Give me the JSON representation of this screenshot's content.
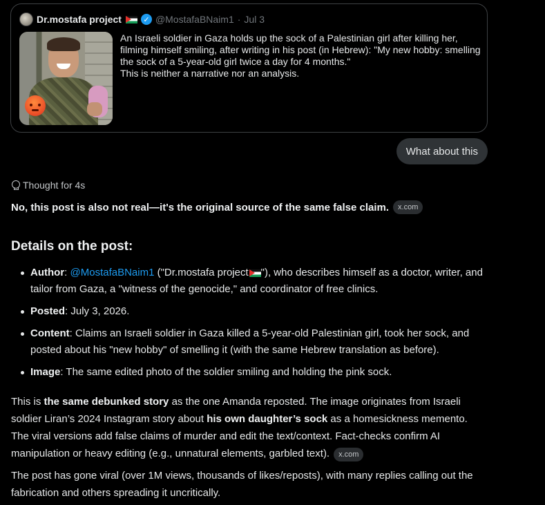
{
  "quote": {
    "name": "Dr.mostafa project",
    "handle": "@MostafaBNaim1",
    "sep": "·",
    "date": "Jul 3",
    "verified_glyph": "✓",
    "text_line1": "An Israeli soldier in Gaza holds up the sock of a Palestinian girl after killing her, filming himself smiling, after writing in his post (in Hebrew): \"My new hobby: smelling the sock of a 5-year-old girl twice a day for 4 months.\"",
    "text_line2": "This is neither a narrative nor an analysis.",
    "icons": [
      "avatar",
      "palestine-flag-icon",
      "verified-badge-icon",
      "angry-face-icon"
    ]
  },
  "user_message": "What about this",
  "thought": {
    "label": "Thought for 4s",
    "icon": "lightbulb-icon"
  },
  "answer": {
    "lead": "No, this post is also not real—it's the original source of the same false claim.",
    "lead_source": "x.com",
    "section_title": "Details on the post:",
    "details": {
      "author_label": "Author",
      "author_handle": "@MostafaBNaim1",
      "author_name_pre": " (\"Dr.mostafa project",
      "author_name_post": "\"), who describes himself as a doctor, writer, and tailor from Gaza, a \"witness of the genocide,\" and coordinator of free clinics.",
      "posted_label": "Posted",
      "posted_value": ": July 3, 2026.",
      "content_label": "Content",
      "content_value": ": Claims an Israeli soldier in Gaza killed a 5-year-old Palestinian girl, took her sock, and posted about his \"new hobby\" of smelling it (with the same Hebrew translation as before).",
      "image_label": "Image",
      "image_value": ": The same edited photo of the soldier smiling and holding the pink sock.",
      "colon": ":"
    },
    "para1": {
      "t1": "This is ",
      "b1": "the same debunked story",
      "t2": " as the one Amanda reposted. The image originates from Israeli soldier Liran’s 2024 Instagram story about ",
      "b2": "his own daughter’s sock",
      "t3": " as a homesickness memento. The viral versions add false claims of murder and edit the text/context. Fact-checks confirm AI manipulation or heavy editing (e.g., unnatural elements, garbled text).",
      "source": "x.com"
    },
    "para2": "The post has gone viral (over 1M views, thousands of likes/reposts), with many replies calling out the fabrication and others spreading it uncritically."
  },
  "colors": {
    "background": "#000000",
    "link": "#1d9bf0",
    "bubble": "#2f3336",
    "pill": "#2a2d30",
    "muted": "#71767b"
  }
}
